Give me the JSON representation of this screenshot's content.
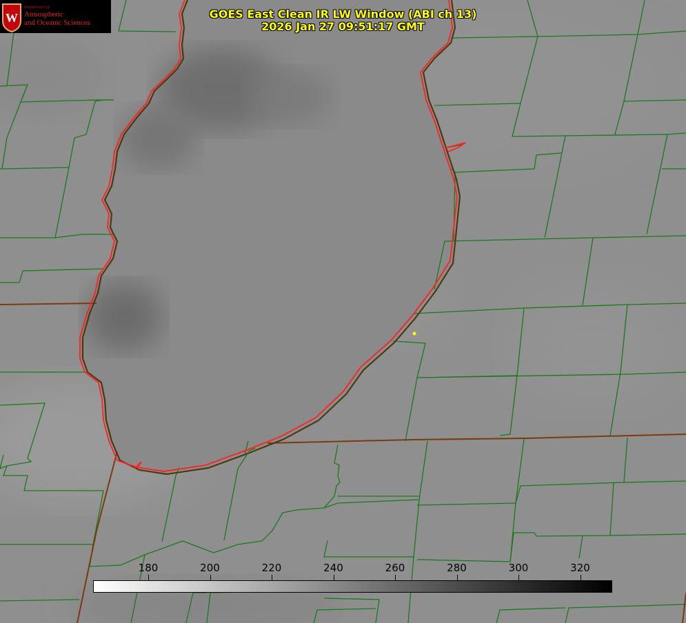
{
  "title": {
    "line1": "GOES East Clean IR LW Window (ABI ch 13)",
    "line2": "2026 Jan 27 09:51:17 GMT"
  },
  "logo": {
    "small_text": "Department of",
    "line1": "Atmospheric",
    "line2": "and Oceanic Sciences",
    "shield_letter": "W"
  },
  "colorbar": {
    "ticks": [
      "180",
      "200",
      "220",
      "240",
      "260",
      "280",
      "300",
      "320"
    ],
    "colors": {
      "low": "#ffffff",
      "high": "#000000"
    }
  },
  "colors": {
    "county_lines": "#1a7a1a",
    "state_lines": "#7a3a10",
    "lake_shore": "#ff2020",
    "title_text": "#ffff00",
    "marker": "#ffff00"
  }
}
